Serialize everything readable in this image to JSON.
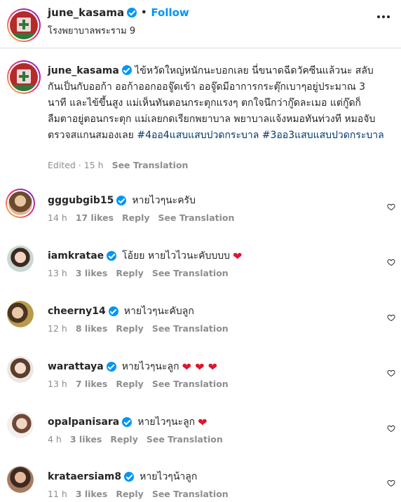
{
  "header": {
    "username": "june_kasama",
    "follow_label": "Follow",
    "separator": "•",
    "location": "โรงพยาบาลพระราม 9"
  },
  "caption": {
    "username": "june_kasama",
    "text": "ไข้หวัดใหญ่หนักนะบอกเลย นี่ขนาดฉีดวัคซีนแล้วนะ สลับกันเป็นกับออก้า ออก้าออกออจู๊ดเข้า ออจู๊ดมีอาการกระตุ๊กเบาๆอยู่ประมาณ 3 นาที และไข้ขึ้นสูง แม่เห็นทันตอนกระตุกแรงๆ ตกใจนึกว่ากู๊ดละเมอ แต่กู๊ดก็ลืมตาอยู่ตอนกระตุก แม่เลยกดเรียกพยาบาล พยาบาลแจ้งหมอทันท่วงที หมอจับตรวจสแกนสมองเลย",
    "hashtag1": "#4ออ4แสบแสบปวดกระบาล",
    "hashtag2": "#3ออ3แสบแสบปวดกระบาล",
    "edited": "Edited · 15 h",
    "see_translation": "See Translation"
  },
  "labels": {
    "reply": "Reply",
    "see_translation": "See Translation"
  },
  "comments": [
    {
      "username": "gggubgib15",
      "text": "หายไวๆนะครับ",
      "hearts": "",
      "time": "14 h",
      "likes": "17 likes"
    },
    {
      "username": "iamkratae",
      "text": "โอ้ยย หายไวไวนะคับบบบ",
      "hearts": "❤",
      "time": "13 h",
      "likes": "3 likes"
    },
    {
      "username": "cheerny14",
      "text": "หายไวๆนะคับลูก",
      "hearts": "",
      "time": "12 h",
      "likes": "8 likes"
    },
    {
      "username": "warattaya",
      "text": "หายไวๆนะลูก",
      "hearts": "❤ ❤ ❤",
      "time": "13 h",
      "likes": "7 likes"
    },
    {
      "username": "opalpanisara",
      "text": "หายไวๆนะลูก",
      "hearts": "❤",
      "time": "4 h",
      "likes": "3 likes"
    },
    {
      "username": "krataersiam8",
      "text": "หายไวๆน้าลูก",
      "hearts": "",
      "time": "11 h",
      "likes": "3 likes"
    }
  ],
  "colors": {
    "accent": "#0095f6",
    "hashtag": "#00376b",
    "muted": "#8e8e8e",
    "heart_emoji": "#e0142c"
  }
}
